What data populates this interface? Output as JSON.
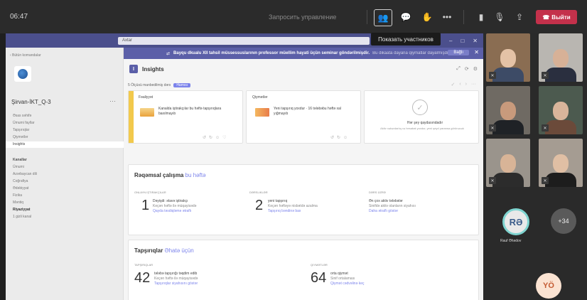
{
  "topbar": {
    "time": "06:47",
    "request_control": "Запросить управление",
    "leave_label": "Выйти",
    "icons": [
      "people-icon",
      "chat-icon",
      "reactions-icon",
      "more-icon",
      "video-icon",
      "mic-off-icon",
      "share-icon"
    ]
  },
  "tooltip": "Показать участников",
  "app": {
    "search_placeholder": "Axtar",
    "banner_bold": "Bayqu dkualu XII tahsil müssessuslarının professor müellim hayati üçün seminar göndərilmişdir.",
    "banner_small": "Bu dikaata dayana qiymatlar dayalmışdır",
    "banner_button": "Bağlı"
  },
  "sidebar": {
    "back": "‹ Bütün komandalar",
    "team_name": "Şirvan-İKT_Q-3",
    "items": [
      "Əsas səhifə",
      "Ümumi fayllar",
      "Tapşırıqlar",
      "Qiymətlər",
      "Insights"
    ],
    "channels_head": "Kanallar",
    "channels": [
      "Ümumi",
      "Azərbaycan dili",
      "Coğrafiya",
      "Ədəbiyyat",
      "Fizika",
      "Məntiq",
      "Riyaziyyat",
      "1 gizli kanal"
    ]
  },
  "insights": {
    "title": "Insights",
    "filter_text": "5 Ölçüsü manbedilmiş dərs",
    "filter_badge": "Hamısı",
    "cards": [
      {
        "title": "Fəaliyyət",
        "text": "Kanalda iştirakçılar bu həftə tapşırıqlara baxılmayıb"
      },
      {
        "title": "Qiymətlər",
        "text": "Yeni tapşırıq yoxdur · 16 tələbəbu həftə xal yığmayıb"
      },
      {
        "title": "",
        "text": "Hər şey qaydasındadır",
        "sub": "Aktiv xəbərdarlıq və hesabat yoxdur, yeni qeyd yaransa görünəcək"
      }
    ]
  },
  "activity": {
    "title_bold": "Rəqəmsal çalışma",
    "title_rest": "bu həftə",
    "stats": [
      {
        "label": "Onlayn iştirakçılar",
        "value": "1",
        "line": "Dəyişdi: əlavə iştirakçı",
        "sub": "Keçən həftə ilə müqayisədə",
        "link": "Qayda təsdiqləmə ətraflı"
      },
      {
        "label": "Dərsliklər",
        "value": "2",
        "line": "yeni tapşırıq",
        "sub": "Keçən həftəyə nisbətdə azalma",
        "link": "Tapşırıq bəndinə bax"
      },
      {
        "label": "Dərs üzrə",
        "value": "",
        "line": "Ən çox aktiv tələbələr",
        "sub": "Sinifdə aktiv olanların siyahısı",
        "link": "Daha ətraflı göstər"
      }
    ]
  },
  "assignments": {
    "title_bold": "Tapşırıqlar",
    "title_rest": "Əhatə üçün",
    "stats": [
      {
        "label": "Tapşırıqlar",
        "value": "42",
        "line": "tələbə tapşırığı təqdim edib",
        "sub": "Keçən həftə ilə müqayisədə",
        "link": "Tapşırıqlar siyahısını göstər"
      },
      {
        "label": "Qiymətlər",
        "value": "64",
        "line": "orta qiymət",
        "sub": "Sinif ortalaması",
        "link": "Qiymət cədvəlinə keç"
      }
    ]
  },
  "gallery": {
    "rd_initials": "RƏ",
    "rd_name": "Rauf Əhədov",
    "more_count": "+34",
    "yo_initials": "YÖ"
  }
}
